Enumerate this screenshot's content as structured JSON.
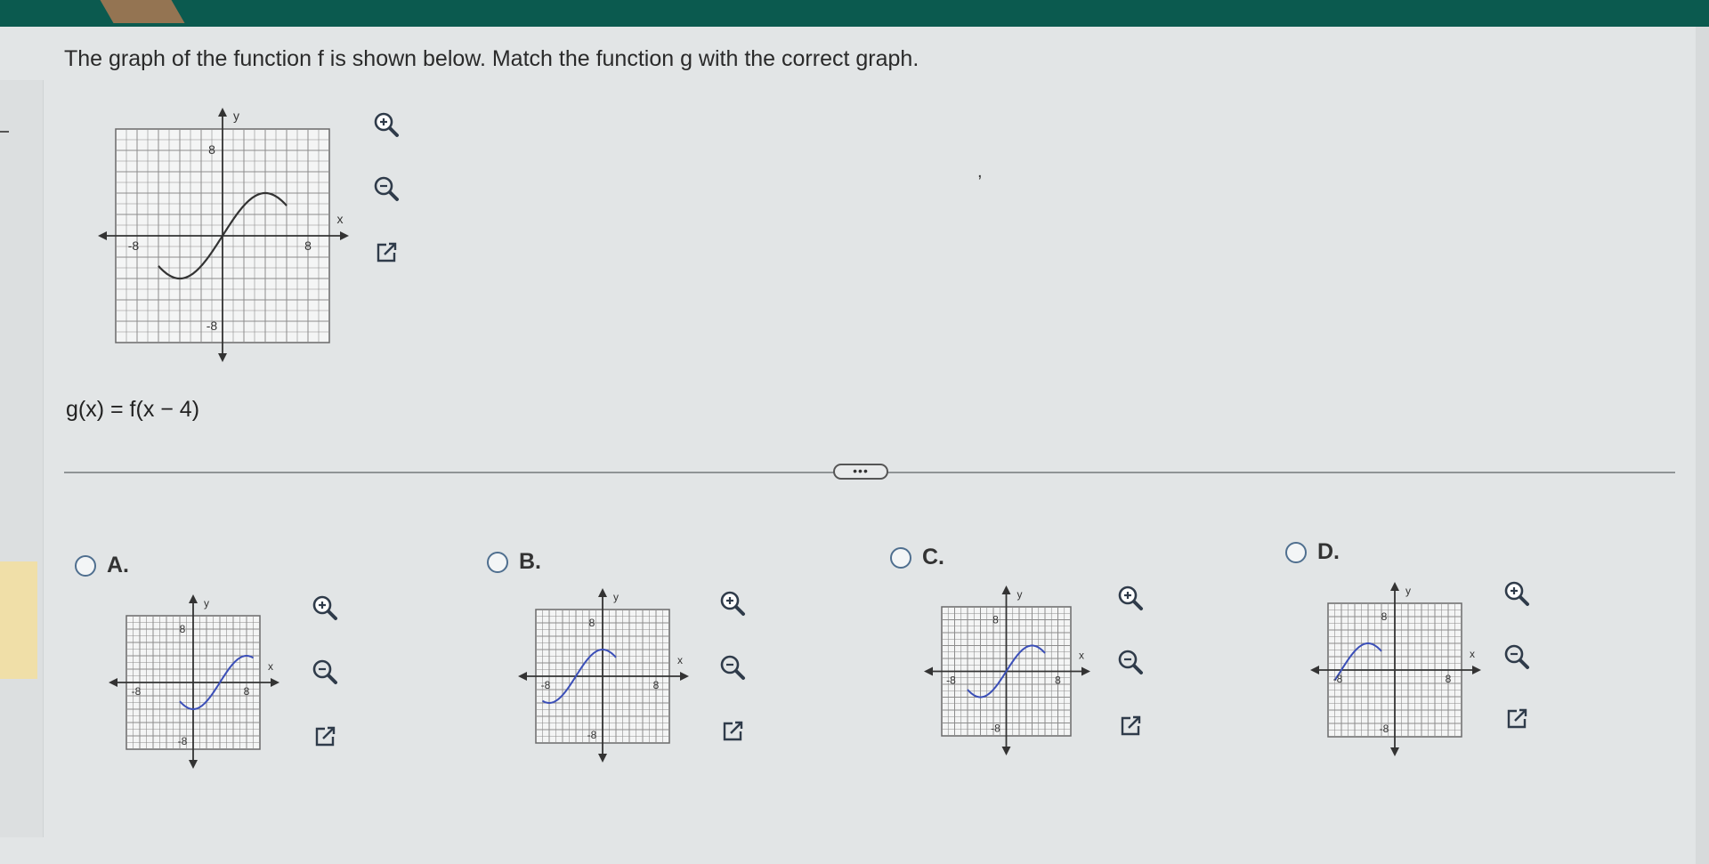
{
  "question": "The graph of the function f is shown below. Match the function g with the correct graph.",
  "function_label": "g(x) = f(x − 4)",
  "more_button": "•••",
  "axis": {
    "x": "x",
    "y": "y",
    "max": "8",
    "min": "-8"
  },
  "stray_comma": ",",
  "choices": [
    {
      "label": "A."
    },
    {
      "label": "B."
    },
    {
      "label": "C."
    },
    {
      "label": "D."
    }
  ],
  "icons": {
    "zoom_in": "zoom-in-icon",
    "zoom_out": "zoom-out-icon",
    "external": "external-link-icon"
  },
  "colors": {
    "curve_main": "#333333",
    "curve_choice": "#3b4fb8",
    "grid": "#8c8c8c",
    "topbar": "#0b5a4f"
  }
}
